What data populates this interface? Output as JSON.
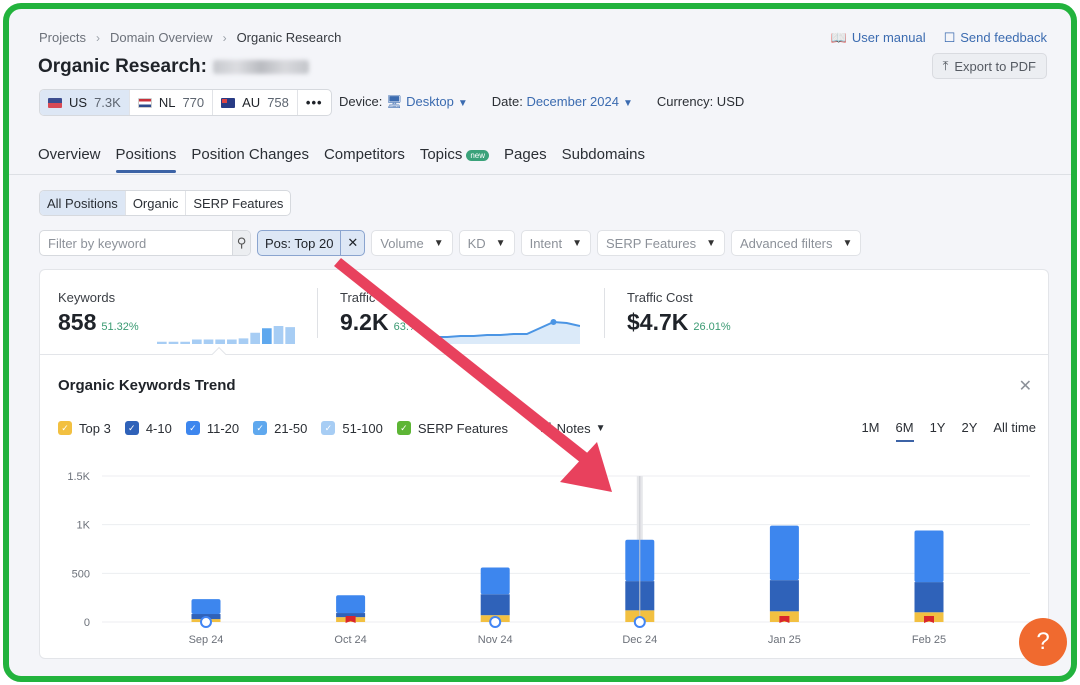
{
  "breadcrumb": [
    "Projects",
    "Domain Overview",
    "Organic Research"
  ],
  "header": {
    "title": "Organic Research:",
    "domain_redacted": true,
    "user_manual": "User manual",
    "send_feedback": "Send feedback",
    "export": "Export to PDF"
  },
  "databases": [
    {
      "code": "US",
      "count": "7.3K",
      "flag": "us",
      "active": true
    },
    {
      "code": "NL",
      "count": "770",
      "flag": "nl",
      "active": false
    },
    {
      "code": "AU",
      "count": "758",
      "flag": "au",
      "active": false
    },
    {
      "code": "•••",
      "count": "",
      "flag": "",
      "active": false
    }
  ],
  "meta": {
    "device_label": "Device:",
    "device_value": "Desktop",
    "date_label": "Date:",
    "date_value": "December 2024",
    "currency": "Currency: USD"
  },
  "tabs": [
    {
      "label": "Overview",
      "active": false
    },
    {
      "label": "Positions",
      "active": true
    },
    {
      "label": "Position Changes",
      "active": false
    },
    {
      "label": "Competitors",
      "active": false
    },
    {
      "label": "Topics",
      "active": false,
      "badge": "new"
    },
    {
      "label": "Pages",
      "active": false
    },
    {
      "label": "Subdomains",
      "active": false
    }
  ],
  "segments": [
    {
      "label": "All Positions",
      "active": true
    },
    {
      "label": "Organic",
      "active": false
    },
    {
      "label": "SERP Features",
      "active": false
    }
  ],
  "filters": {
    "search_placeholder": "Filter by keyword",
    "search_value": "",
    "active_chip": "Pos: Top 20",
    "dropdowns": [
      "Volume",
      "KD",
      "Intent",
      "SERP Features",
      "Advanced filters"
    ]
  },
  "metrics": [
    {
      "label": "Keywords",
      "value": "858",
      "change": "51.32%"
    },
    {
      "label": "Traffic",
      "value": "9.2K",
      "change": "63.%"
    },
    {
      "label": "Traffic Cost",
      "value": "$4.7K",
      "change": "26.01%"
    }
  ],
  "sparklines": {
    "keywords_bars": [
      2,
      2,
      2,
      4,
      4,
      4,
      4,
      5,
      10,
      14,
      16,
      15
    ],
    "traffic_line": [
      3,
      3,
      4,
      4,
      5,
      5,
      6,
      6,
      12,
      18,
      17,
      14
    ]
  },
  "trend": {
    "title": "Organic Keywords Trend",
    "legend": [
      {
        "label": "Top 3",
        "color": "#f2c041"
      },
      {
        "label": "4-10",
        "color": "#2f62b9"
      },
      {
        "label": "11-20",
        "color": "#3d86ee"
      },
      {
        "label": "21-50",
        "color": "#5fa8ee"
      },
      {
        "label": "51-100",
        "color": "#a7cdf4"
      },
      {
        "label": "SERP Features",
        "color": "#5db535"
      }
    ],
    "notes_label": "Notes",
    "ranges": [
      {
        "label": "1M",
        "active": false
      },
      {
        "label": "6M",
        "active": true
      },
      {
        "label": "1Y",
        "active": false
      },
      {
        "label": "2Y",
        "active": false
      },
      {
        "label": "All time",
        "active": false
      }
    ]
  },
  "chart_data": {
    "type": "bar",
    "stacked": true,
    "title": "Organic Keywords Trend",
    "categories": [
      "Sep 24",
      "Oct 24",
      "Nov 24",
      "Dec 24",
      "Jan 25",
      "Feb 25"
    ],
    "series": [
      {
        "name": "Top 3",
        "color": "#f2c041",
        "values": [
          30,
          50,
          70,
          120,
          110,
          100
        ]
      },
      {
        "name": "4-10",
        "color": "#2f62b9",
        "values": [
          52,
          42,
          215,
          300,
          320,
          310
        ]
      },
      {
        "name": "11-20",
        "color": "#3d86ee",
        "values": [
          153,
          183,
          275,
          425,
          560,
          530
        ]
      }
    ],
    "markers": [
      "google",
      "flag",
      "google",
      "google",
      "flag",
      "flag"
    ],
    "highlighted_category": "Dec 24",
    "yticks": [
      "0",
      "500",
      "1K",
      "1.5K"
    ],
    "ylim": [
      0,
      1500
    ],
    "grid": true,
    "xlabel": "",
    "ylabel": ""
  },
  "help_label": "?"
}
